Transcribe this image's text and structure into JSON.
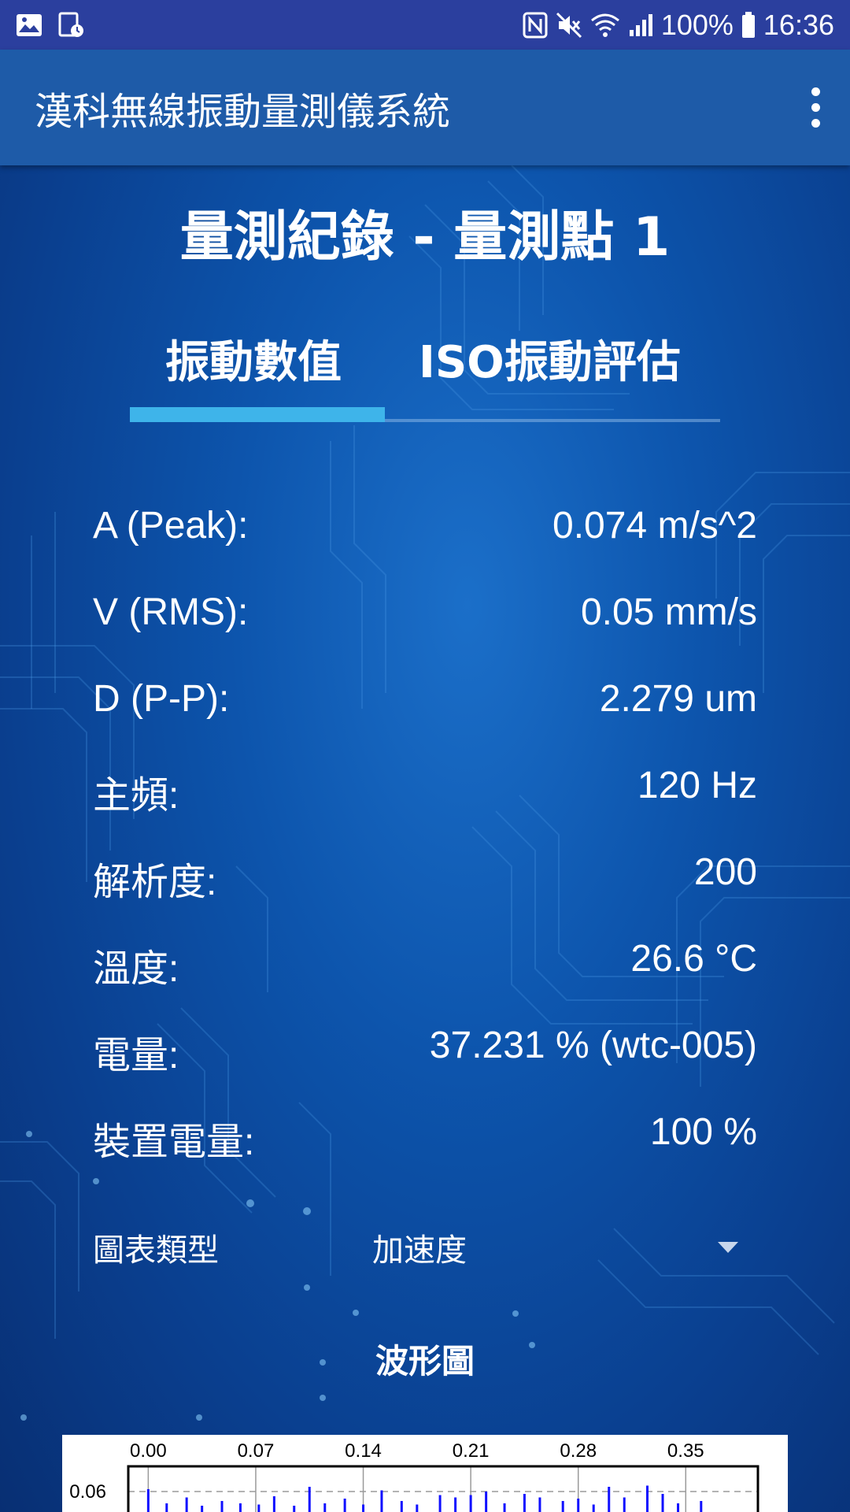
{
  "status_bar": {
    "battery_text": "100%",
    "time": "16:36",
    "icons": [
      "image-icon",
      "calendar-clock-icon",
      "nfc-icon",
      "mute-vibrate-icon",
      "wifi-icon",
      "signal-icon",
      "battery-icon"
    ]
  },
  "app_bar": {
    "title": "漢科無線振動量測儀系統",
    "menu_icon": "more-vert-icon"
  },
  "page": {
    "title": "量測紀錄 - 量測點 1"
  },
  "tabs": [
    {
      "label": "振動數值",
      "active": true
    },
    {
      "label": "ISO振動評估",
      "active": false
    }
  ],
  "metrics": [
    {
      "label": "A (Peak):",
      "value": "0.074 m/s^2"
    },
    {
      "label": "V (RMS):",
      "value": "0.05 mm/s"
    },
    {
      "label": "D (P-P):",
      "value": "2.279 um"
    },
    {
      "label": "主頻:",
      "value": "120 Hz"
    },
    {
      "label": "解析度:",
      "value": "200"
    },
    {
      "label": "溫度:",
      "value": "26.6 °C"
    },
    {
      "label": "電量:",
      "value": "37.231 % (wtc-005)"
    },
    {
      "label": "裝置電量:",
      "value": "100 %"
    }
  ],
  "chart_type": {
    "label": "圖表類型",
    "selected": "加速度",
    "icon": "dropdown-arrow-icon"
  },
  "chart_section": {
    "title": "波形圖"
  },
  "colors": {
    "status_bar": "#2b3f9e",
    "app_bar": "#1e5ba8",
    "tab_indicator": "#3eb4ea",
    "waveform": "#1010ff"
  },
  "chart_data": {
    "type": "line",
    "x_ticks": [
      "0.00",
      "0.07",
      "0.14",
      "0.21",
      "0.28",
      "0.35"
    ],
    "y_ticks": [
      "0.06"
    ],
    "xlim": [
      -0.013,
      0.397
    ],
    "grid": true,
    "series": [
      {
        "x": [
          0.0,
          0.012,
          0.025,
          0.035,
          0.048,
          0.06,
          0.072,
          0.082,
          0.095,
          0.105,
          0.115,
          0.128,
          0.14,
          0.152,
          0.165,
          0.175,
          0.19,
          0.2,
          0.21,
          0.22,
          0.232,
          0.245,
          0.255,
          0.27,
          0.28,
          0.29,
          0.3,
          0.31,
          0.325,
          0.335,
          0.345,
          0.36
        ],
        "y": [
          0.062,
          0.05,
          0.055,
          0.048,
          0.052,
          0.05,
          0.049,
          0.056,
          0.048,
          0.064,
          0.05,
          0.054,
          0.049,
          0.061,
          0.052,
          0.049,
          0.057,
          0.055,
          0.057,
          0.06,
          0.05,
          0.058,
          0.055,
          0.052,
          0.054,
          0.049,
          0.064,
          0.055,
          0.065,
          0.058,
          0.05,
          0.052
        ]
      }
    ]
  }
}
